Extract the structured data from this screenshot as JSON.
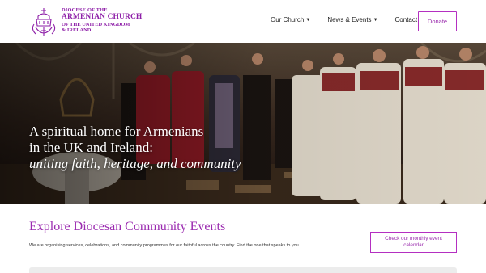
{
  "brand": {
    "line1": "DIOCESE OF THE",
    "line2": "ARMENIAN CHURCH",
    "line3": "OF THE UNITED KINGDOM",
    "line4": "& IRELAND",
    "color": "#8e1fa8"
  },
  "nav": {
    "items": [
      {
        "label": "Our Church"
      },
      {
        "label": "News & Events"
      },
      {
        "label": "Contact"
      }
    ],
    "donate_label": "Donate"
  },
  "hero": {
    "line1": "A spiritual home for Armenians",
    "line2": "in the UK and Ireland:",
    "line3": "uniting faith, heritage, and community"
  },
  "events": {
    "title": "Explore Diocesan Community Events",
    "description": "We are organising services, celebrations, and community programmes for our faithful across the country. Find the one that speaks to you.",
    "calendar_button": "Check our monthly event calendar"
  },
  "colors": {
    "accent": "#9b2bb0",
    "button_border": "#b42fc1"
  }
}
